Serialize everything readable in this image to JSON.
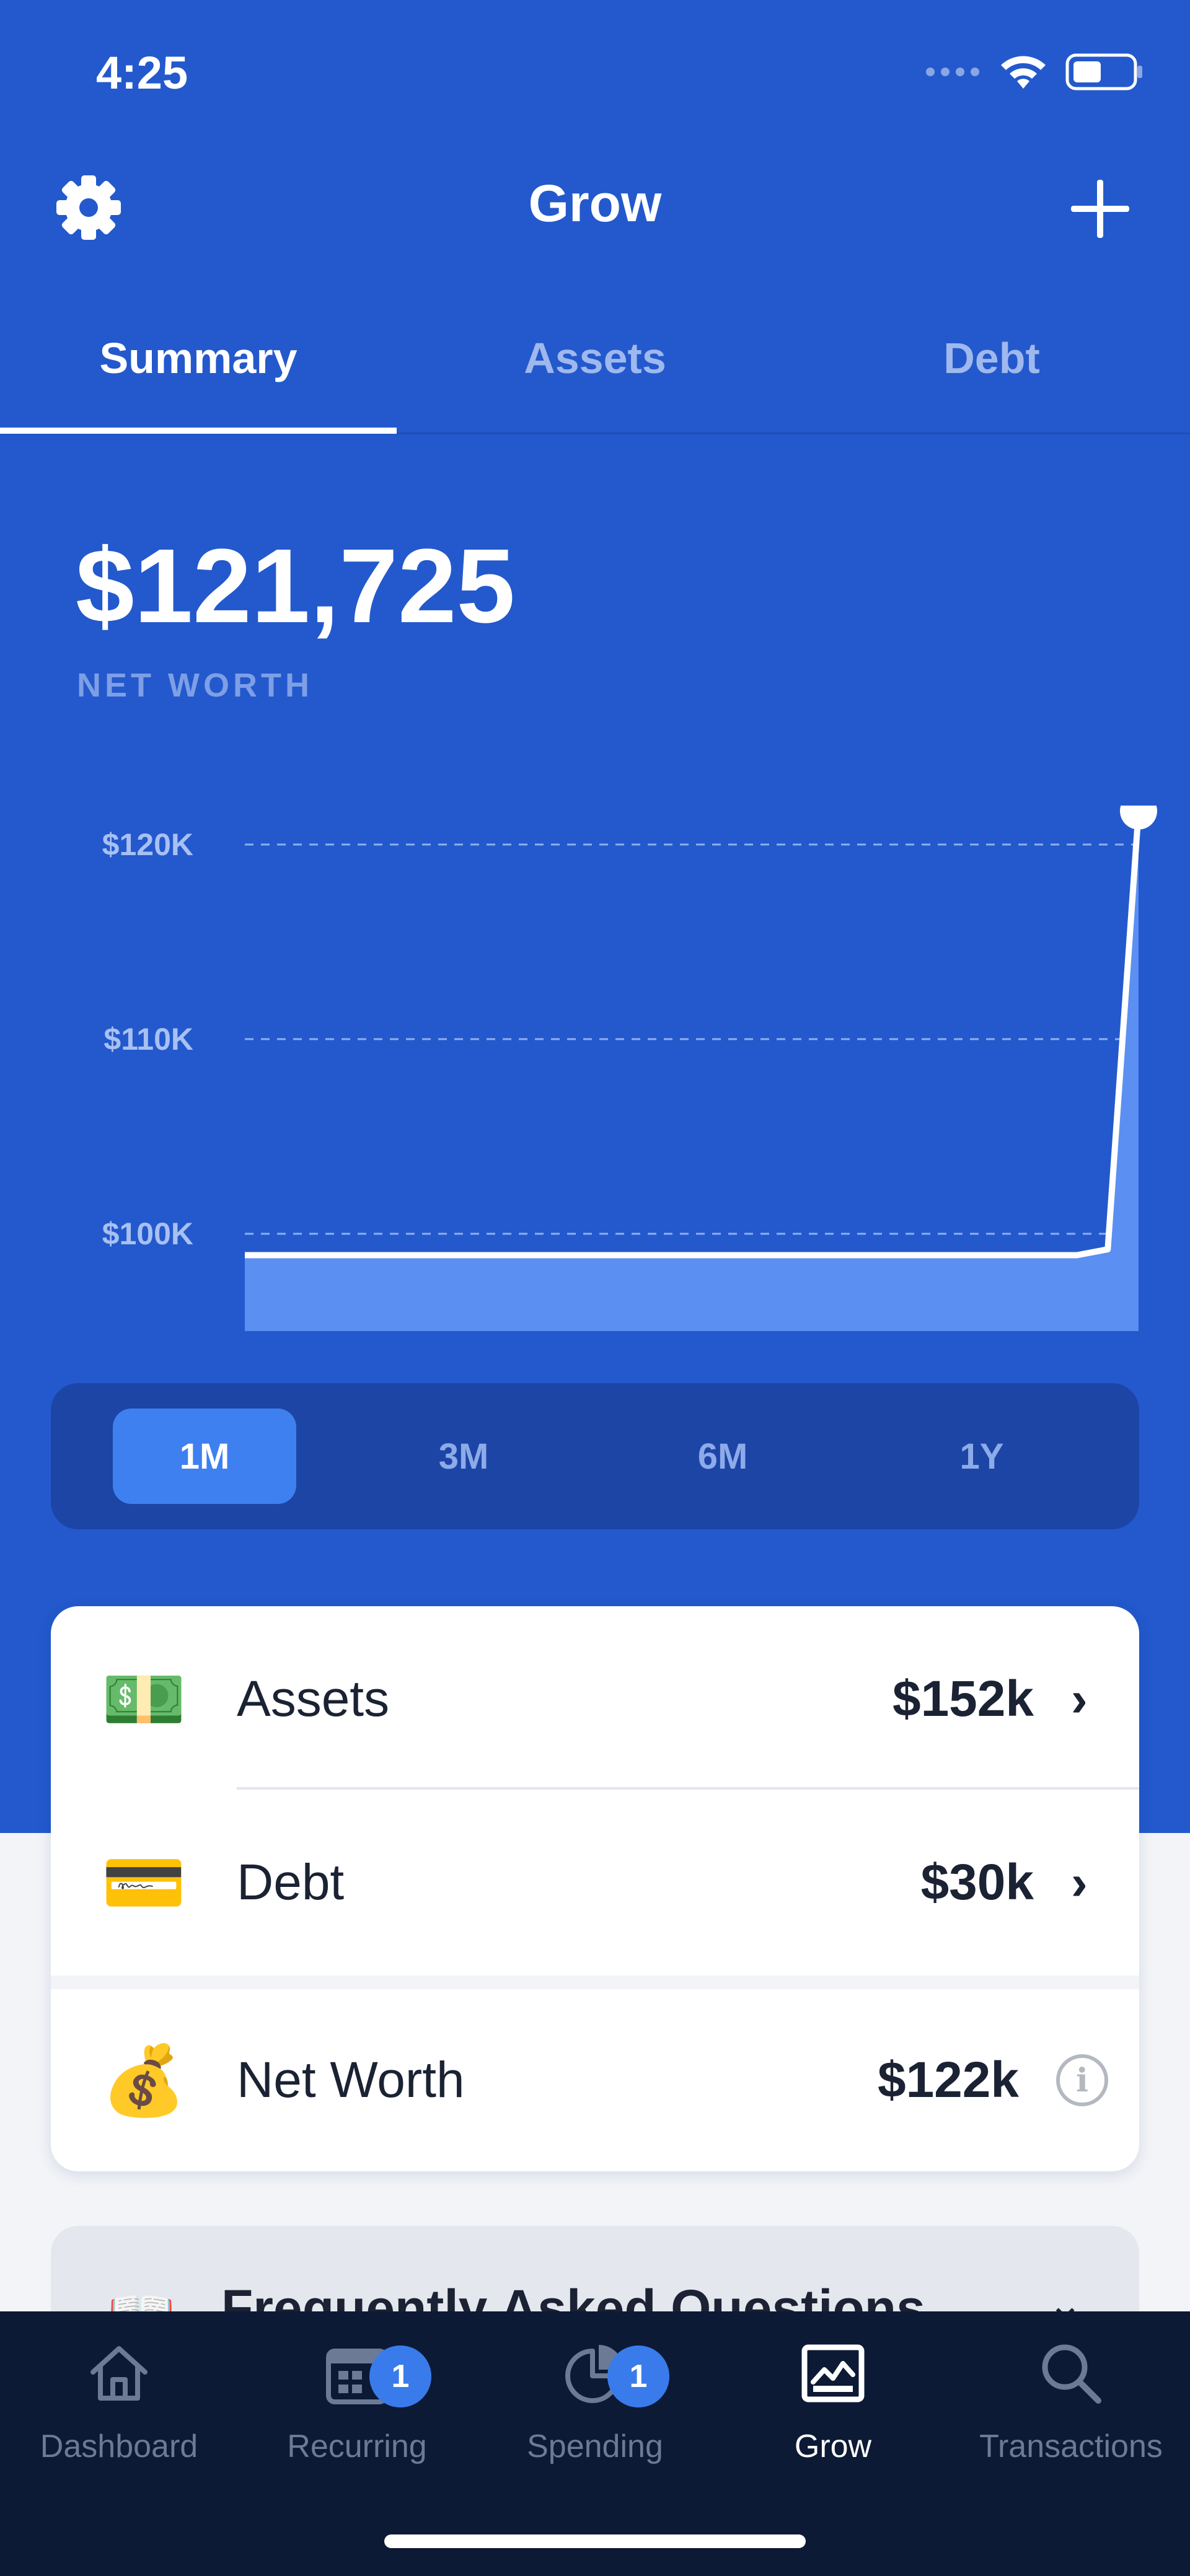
{
  "status_bar": {
    "time": "4:25"
  },
  "header": {
    "title": "Grow",
    "settings_icon": "gear-icon",
    "add_icon": "plus-icon"
  },
  "tabs": [
    {
      "label": "Summary",
      "active": true
    },
    {
      "label": "Assets",
      "active": false
    },
    {
      "label": "Debt",
      "active": false
    }
  ],
  "net_worth": {
    "value": "$121,725",
    "label": "NET WORTH"
  },
  "chart_data": {
    "type": "area",
    "y_ticks": [
      "$120K",
      "$110K",
      "$100K"
    ],
    "ylim": [
      95000,
      122000
    ],
    "x": [
      0,
      1,
      2,
      3,
      4,
      5,
      6,
      7,
      8,
      9,
      10,
      11,
      12,
      13,
      14,
      15,
      16,
      17,
      18,
      19,
      20,
      21,
      22,
      23,
      24,
      25,
      26,
      27,
      28,
      29
    ],
    "values": [
      98900,
      98900,
      98900,
      98900,
      98900,
      98900,
      98900,
      98900,
      98900,
      98900,
      98900,
      98900,
      98900,
      98900,
      98900,
      98900,
      98900,
      98900,
      98900,
      98900,
      98900,
      98900,
      98900,
      98900,
      98900,
      98900,
      98900,
      98900,
      99200,
      121725
    ],
    "grid": true,
    "colors": {
      "line": "#ffffff",
      "fill": "#5b8ff2",
      "grid": "#8fb0ee"
    }
  },
  "range_selector": {
    "options": [
      "1M",
      "3M",
      "6M",
      "1Y"
    ],
    "selected": "1M"
  },
  "summary_card": {
    "rows": [
      {
        "emoji": "💵",
        "label": "Assets",
        "amount": "$152k",
        "trailing": "chevron"
      },
      {
        "emoji": "💳",
        "label": "Debt",
        "amount": "$30k",
        "trailing": "chevron"
      },
      {
        "emoji": "💰",
        "label": "Net Worth",
        "amount": "$122k",
        "trailing": "info"
      }
    ]
  },
  "faq": {
    "title": "Frequently Asked Questions",
    "emoji": "📖"
  },
  "bottom_nav": [
    {
      "label": "Dashboard",
      "icon": "home-icon",
      "badge": ""
    },
    {
      "label": "Recurring",
      "icon": "calendar-icon",
      "badge": "1"
    },
    {
      "label": "Spending",
      "icon": "pie-chart-icon",
      "badge": "1"
    },
    {
      "label": "Grow",
      "icon": "line-chart-icon",
      "badge": "",
      "active": true
    },
    {
      "label": "Transactions",
      "icon": "search-icon",
      "badge": ""
    }
  ]
}
